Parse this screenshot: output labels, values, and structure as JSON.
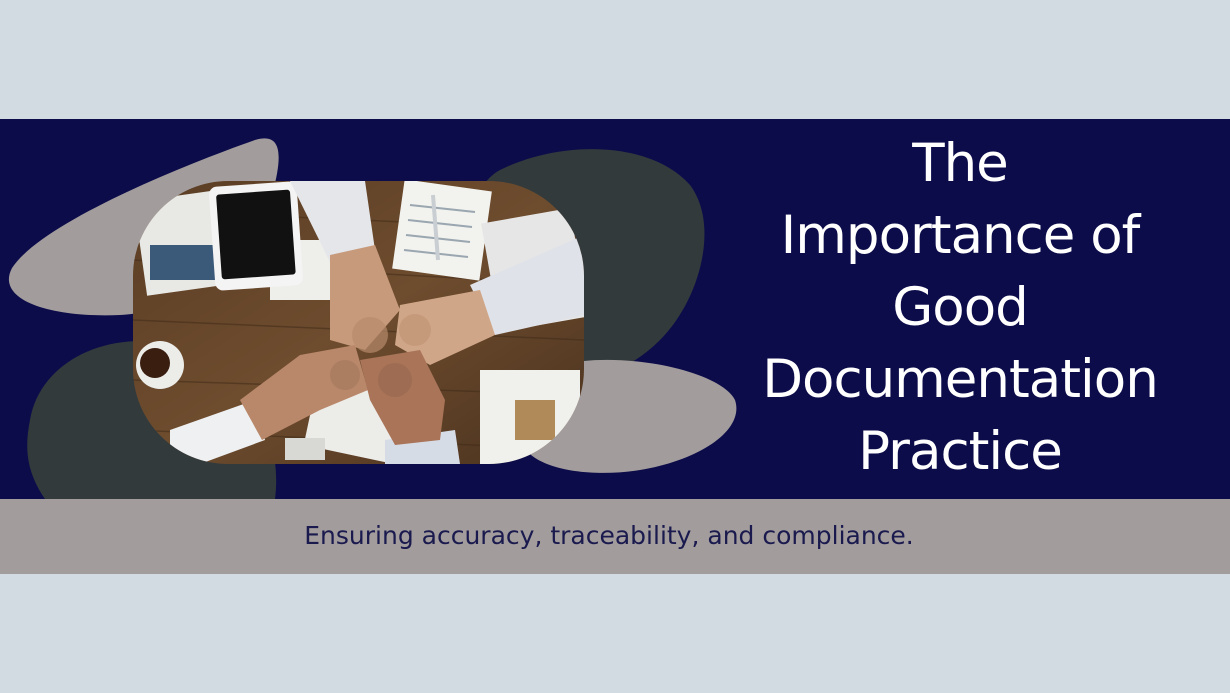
{
  "title": {
    "lines": [
      "The",
      "Importance of",
      "Good",
      "Documentation",
      "Practice"
    ]
  },
  "subtitle": "Ensuring accuracy, traceability, and compliance.",
  "colors": {
    "background": "#d2dbe2",
    "banner": "#0c0c4a",
    "band": "#a29c9c",
    "title_text": "#ffffff",
    "subtitle_text": "#1a1a4e",
    "blob_gray": "#a29c9c",
    "blob_dark": "#333a3c"
  }
}
